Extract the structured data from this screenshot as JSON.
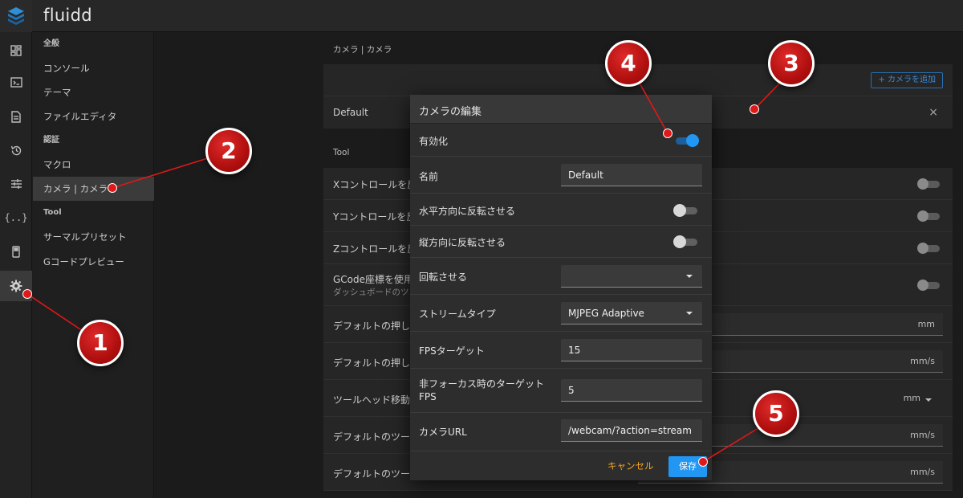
{
  "app": {
    "title": "fluidd"
  },
  "nav": {
    "items": [
      {
        "label": "全般",
        "head": true
      },
      {
        "label": "コンソール"
      },
      {
        "label": "テーマ"
      },
      {
        "label": "ファイルエディタ"
      },
      {
        "label": "認証",
        "head": true
      },
      {
        "label": "マクロ"
      },
      {
        "label": "カメラ | カメラ",
        "active": true
      },
      {
        "label": "Tool",
        "head": true
      },
      {
        "label": "サーマルプリセット"
      },
      {
        "label": "Gコードプレビュー"
      }
    ]
  },
  "main": {
    "camera_section_title": "カメラ | カメラ",
    "add_camera_label": "+ カメラを追加",
    "camera_entry_name": "Default",
    "close_glyph": "×",
    "tool_section_title": "Tool",
    "tool_rows": {
      "x_control": "Xコントロールを反",
      "y_control": "Yコントロールを反",
      "z_control": "Zコントロールを反",
      "gcode_coords": "GCode座標を使用",
      "gcode_coords_sub": "ダッシュボードのツ",
      "default_push_1": "デフォルトの押し",
      "default_push_2": "デフォルトの押し",
      "toolhead_move": "ツールヘッド移動",
      "default_tool_1": "デフォルトのツー",
      "default_tool_2": "デフォルトのツー"
    },
    "units": {
      "mm": "mm",
      "mms": "mm/s"
    }
  },
  "dialog": {
    "title": "カメラの編集",
    "enabled_label": "有効化",
    "enabled": true,
    "name_label": "名前",
    "name_value": "Default",
    "flip_h_label": "水平方向に反転させる",
    "flip_h": false,
    "flip_v_label": "縦方向に反転させる",
    "flip_v": false,
    "rotate_label": "回転させる",
    "rotate_value": "",
    "stream_type_label": "ストリームタイプ",
    "stream_type_value": "MJPEG Adaptive",
    "fps_label": "FPSターゲット",
    "fps_value": "15",
    "unfocus_fps_label_1": "非フォーカス時のターゲット",
    "unfocus_fps_label_2": "FPS",
    "unfocus_fps_value": "5",
    "url_label": "カメラURL",
    "url_value": "/webcam/?action=stream",
    "cancel_label": "キャンセル",
    "save_label": "保存"
  },
  "annotations": [
    "1",
    "2",
    "3",
    "4",
    "5"
  ],
  "colors": {
    "accent": "#2196f3",
    "cancel": "#f5a623",
    "badge": "#c41414"
  }
}
